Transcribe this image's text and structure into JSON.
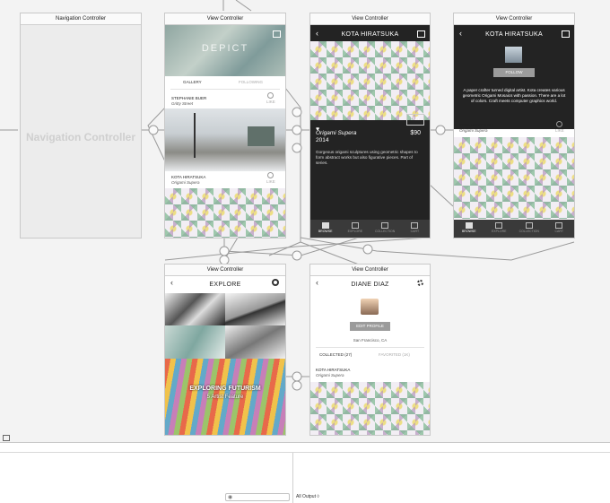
{
  "canvas": {
    "bg": "#f3f3f3"
  },
  "nav_controller": {
    "title": "Navigation Controller",
    "body_label": "Navigation Controller"
  },
  "gallery": {
    "title": "View Controller",
    "banner_text": "DEPICT",
    "tab_gallery": "GALLERY",
    "tab_following": "FOLLOWING",
    "item1": {
      "artist": "STEPHANIE BUER",
      "work": "Gritty Street",
      "like": "LIKE"
    },
    "item2": {
      "artist": "KOTA HIRATSUKA",
      "work": "Origami Supera",
      "like": "LIKE"
    }
  },
  "detail": {
    "title": "View Controller",
    "header": "KOTA HIRATSUKA",
    "buy": "BUY",
    "work": "Origami Supera",
    "year": "2014",
    "price": "$90",
    "description": "Gorgeous origami sculptures using geometric shapes to form abstract works but also figurative pieces. Part of series.",
    "tabs": [
      "BROWSE",
      "EXPLORE",
      "COLLECTION",
      "CART"
    ]
  },
  "profile": {
    "title": "View Controller",
    "header": "KOTA HIRATSUKA",
    "follow": "FOLLOW",
    "bio": "A paper crafter turned digital artist. Kota creates various geometric Origami Mosaics with passion. There are a lot of colors. Craft meets computer graphics world.",
    "artist": "KOTA HIRATSUKA",
    "work": "Origami Supera",
    "like": "LIKE",
    "tabs": [
      "BROWSE",
      "EXPLORE",
      "COLLECTION",
      "CART"
    ]
  },
  "explore": {
    "title": "View Controller",
    "header": "EXPLORE",
    "feature_title": "EXPLORING FUTURISM",
    "feature_sub": "5 Artist Feature"
  },
  "user": {
    "title": "View Controller",
    "header": "DIANE DIAZ",
    "edit": "EDIT PROFILE",
    "location": "San Francisco, CA",
    "collected": "COLLECTED (27)",
    "favorited": "FAVORITED (1K)",
    "artist": "KOTA HIRATSUKA",
    "work": "Origami Supera"
  },
  "bottom": {
    "output_label": "All Output ◊"
  }
}
